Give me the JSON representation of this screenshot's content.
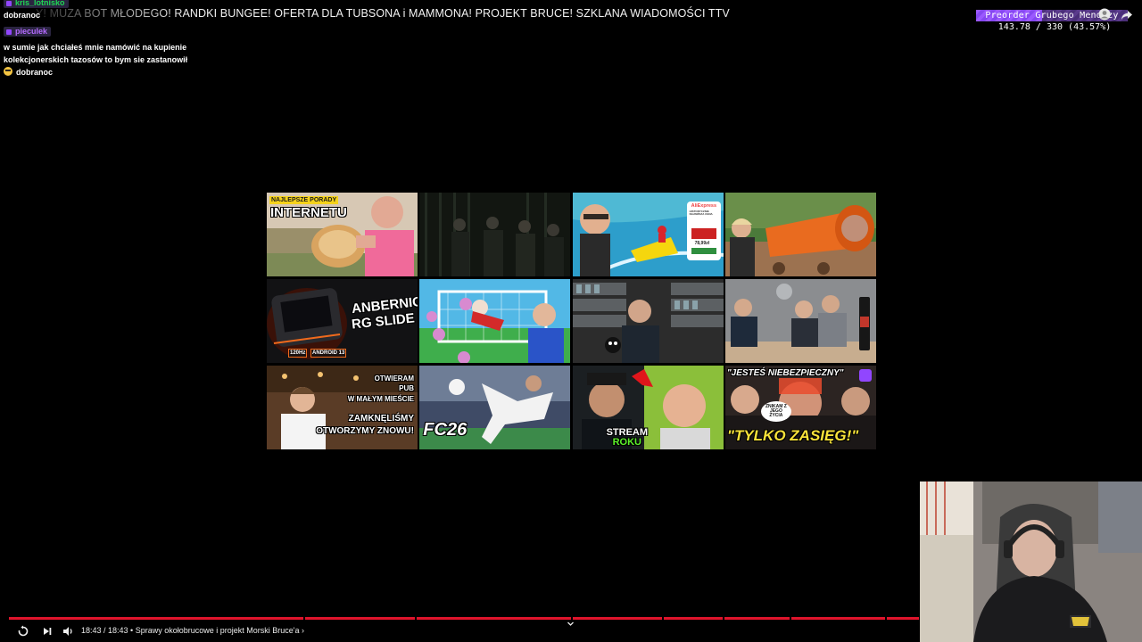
{
  "ticker": {
    "text": "Y! MUZA BOT MŁODEGO! RANDKI BUNGEE! OFERTA DLA TUBSONA i MAMMONA! PROJEKT BRUCE! SZKLANA WIADOMOŚCI TTV"
  },
  "chat": {
    "messages": [
      {
        "username": "kris_lotnisko",
        "text": "dobranoc"
      },
      {
        "username": "pieculek",
        "text": "w sumie jak chciałeś mnie namówić na kupienie kolekcjonerskich tazosów to bym sie zastanowił",
        "extra_text": "dobranoc"
      }
    ]
  },
  "progress": {
    "label": "Preorder Grubego Mendozy",
    "value_text": "143.78 / 330 (43.57%)",
    "fraction": 0.4357,
    "fill_color": "#9b59ff"
  },
  "thumbnails": [
    {
      "id": "t1",
      "caption_small": "NAJLEPSZE PORADY",
      "caption": "INTERNETU"
    },
    {
      "id": "t2",
      "caption": ""
    },
    {
      "id": "t3",
      "badge": "AliExpress",
      "badge_small": "HISTORYCZNIE NAJNIŻSZA CENA",
      "price": "78,99zł"
    },
    {
      "id": "t4",
      "caption": ""
    },
    {
      "id": "t5",
      "caption": "ANBERNIC",
      "caption2": "RG SLIDE",
      "chip1": "120Hz",
      "chip2": "ANDROID 13"
    },
    {
      "id": "t6",
      "caption": ""
    },
    {
      "id": "t7",
      "caption": ""
    },
    {
      "id": "t8",
      "caption": ""
    },
    {
      "id": "t9",
      "line1": "OTWIERAM",
      "line2": "PUB",
      "line3": "W MAŁYM MIEŚCIE",
      "line4": "ZAMKNĘLIŚMY",
      "line5": "OTWORZYMY ZNOWU!"
    },
    {
      "id": "t10",
      "caption": "FC26"
    },
    {
      "id": "t11",
      "line1": "STREAM",
      "line2": "ROKU"
    },
    {
      "id": "t12",
      "line1": "\"JESTEŚ NIEBEZPIECZNY\"",
      "bubble": "ZNIKAM Z JEGO ŻYCIA",
      "line2": "\"TYLKO ZASIĘG!\""
    }
  ],
  "player": {
    "time_text": "18:43 / 18:43 • Sprawy okołobrucowe i projekt Morski Bruce'a ›",
    "progress_fraction": 1.0,
    "seek_color": "#e0142c"
  }
}
